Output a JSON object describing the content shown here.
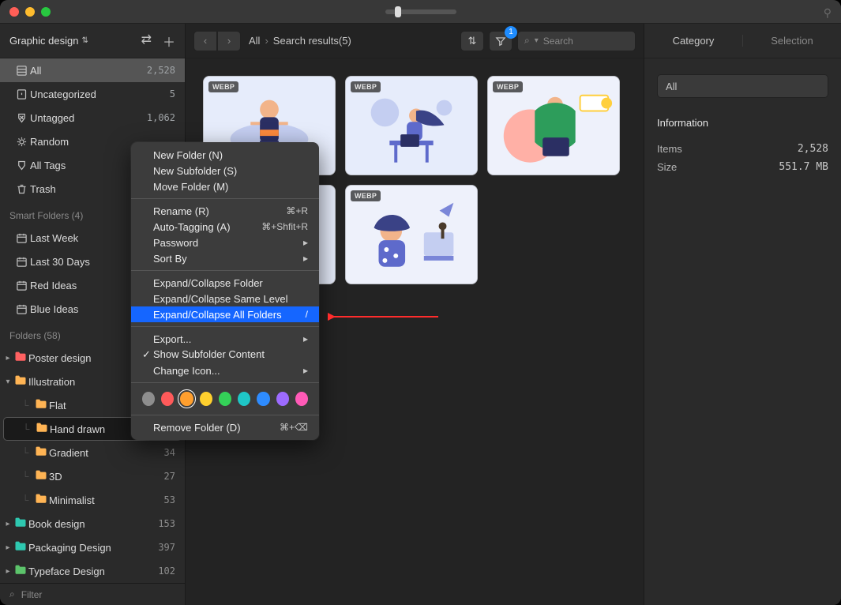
{
  "library": {
    "name": "Graphic design"
  },
  "sidebar": {
    "fixed": [
      {
        "icon": "▤",
        "label": "All",
        "count": "2,528",
        "active": true
      },
      {
        "icon": "?",
        "label": "Uncategorized",
        "count": "5"
      },
      {
        "icon": "✕",
        "label": "Untagged",
        "count": "1,062"
      },
      {
        "icon": "☼",
        "label": "Random",
        "count": ""
      },
      {
        "icon": "◈",
        "label": "All Tags",
        "count": ""
      },
      {
        "icon": "🗑",
        "label": "Trash",
        "count": ""
      }
    ],
    "smart_header": "Smart Folders (4)",
    "smart": [
      {
        "label": "Last Week"
      },
      {
        "label": "Last 30 Days"
      },
      {
        "label": "Red Ideas"
      },
      {
        "label": "Blue Ideas"
      }
    ],
    "folders_header": "Folders (58)",
    "folders": [
      {
        "label": "Poster design",
        "count": "",
        "color": "red",
        "open": false
      },
      {
        "label": "Illustration",
        "count": "",
        "color": "org",
        "open": true,
        "children": [
          {
            "label": "Flat",
            "count": ""
          },
          {
            "label": "Hand drawn",
            "count": "",
            "selected": true
          },
          {
            "label": "Gradient",
            "count": "34"
          },
          {
            "label": "3D",
            "count": "27"
          },
          {
            "label": "Minimalist",
            "count": "53"
          }
        ]
      },
      {
        "label": "Book design",
        "count": "153",
        "color": "cyan",
        "open": false
      },
      {
        "label": "Packaging Design",
        "count": "397",
        "color": "cyan",
        "open": false
      },
      {
        "label": "Typeface Design",
        "count": "102",
        "color": "grn",
        "open": false
      }
    ]
  },
  "filter_placeholder": "Filter",
  "toolbar": {
    "breadcrumb": [
      "All",
      "Search results(5)"
    ],
    "filter_badge": "1",
    "search_placeholder": "Search"
  },
  "thumbs": [
    {
      "badge": "WEBP"
    },
    {
      "badge": "WEBP"
    },
    {
      "badge": "WEBP"
    },
    {
      "badge": "WEBP"
    },
    {
      "badge": "WEBP"
    }
  ],
  "inspector": {
    "tabs": [
      "Category",
      "Selection"
    ],
    "all_pill": "All",
    "info_header": "Information",
    "rows": [
      {
        "k": "Items",
        "v": "2,528"
      },
      {
        "k": "Size",
        "v": "551.7 MB"
      }
    ]
  },
  "context_menu": {
    "groups": [
      [
        {
          "label": "New Folder (N)"
        },
        {
          "label": "New Subfolder (S)"
        },
        {
          "label": "Move Folder (M)"
        }
      ],
      [
        {
          "label": "Rename (R)",
          "shortcut": "⌘+R"
        },
        {
          "label": "Auto-Tagging (A)",
          "shortcut": "⌘+Shfit+R"
        },
        {
          "label": "Password",
          "submenu": true
        },
        {
          "label": "Sort By",
          "submenu": true
        }
      ],
      [
        {
          "label": "Expand/Collapse Folder"
        },
        {
          "label": "Expand/Collapse Same Level"
        },
        {
          "label": "Expand/Collapse All Folders",
          "shortcut": "/",
          "highlight": true
        }
      ],
      [
        {
          "label": "Export...",
          "submenu": true
        },
        {
          "label": "Show Subfolder Content",
          "checked": true
        },
        {
          "label": "Change Icon...",
          "submenu": true
        }
      ]
    ],
    "colors": [
      "#8e8e8e",
      "#ff5a5a",
      "#ff9f2e",
      "#ffd02e",
      "#34d158",
      "#1fc7c7",
      "#2e8cff",
      "#9d6bff",
      "#ff5ab7"
    ],
    "color_selected_index": 2,
    "remove": {
      "label": "Remove Folder (D)",
      "shortcut": "⌘+⌫"
    }
  }
}
